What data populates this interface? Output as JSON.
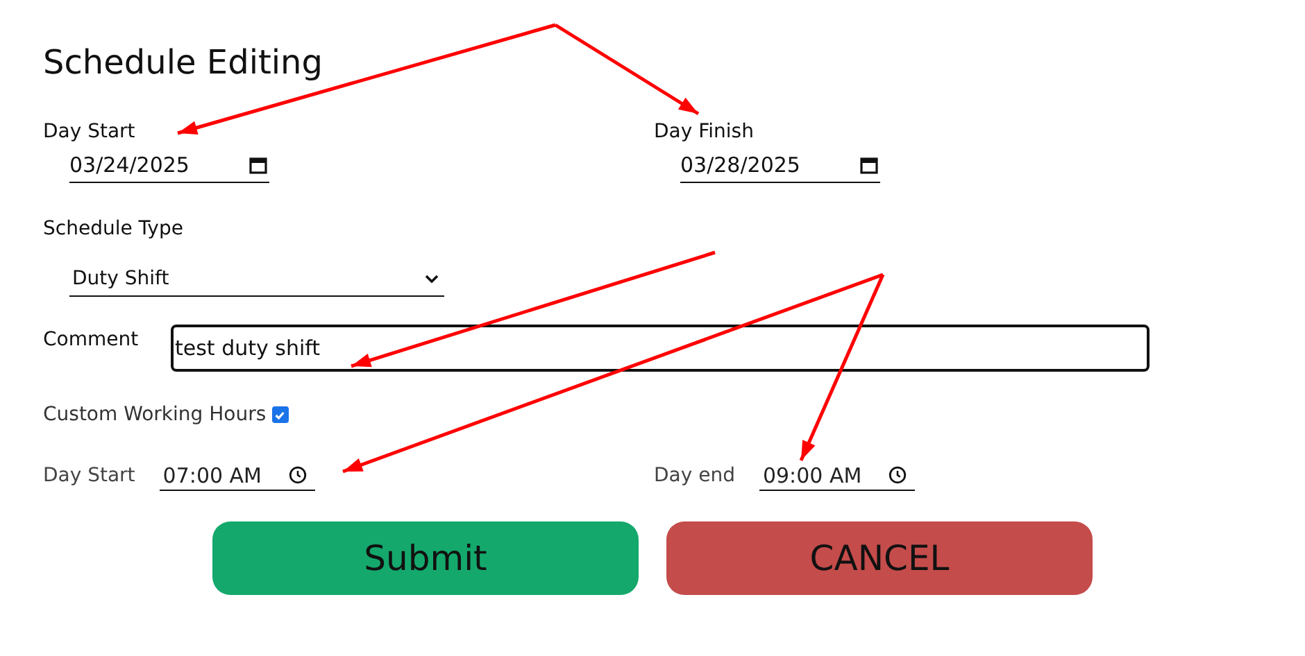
{
  "title": "Schedule Editing",
  "dates": [
    {
      "label": "Day Start",
      "value": "03/24/2025"
    },
    {
      "label": "Day Finish",
      "value": "03/28/2025"
    }
  ],
  "schedule_type": {
    "label": "Schedule Type",
    "value": "Duty Shift"
  },
  "comment": {
    "label": "Comment",
    "value": "test duty shift"
  },
  "custom_hours": {
    "label": "Custom Working Hours",
    "checked": true
  },
  "times": [
    {
      "label": "Day Start",
      "value": "07:00 AM"
    },
    {
      "label": "Day end",
      "value": "09:00 AM"
    }
  ],
  "buttons": [
    {
      "label": "Submit",
      "kind": "submit"
    },
    {
      "label": "CANCEL",
      "kind": "cancel"
    }
  ]
}
